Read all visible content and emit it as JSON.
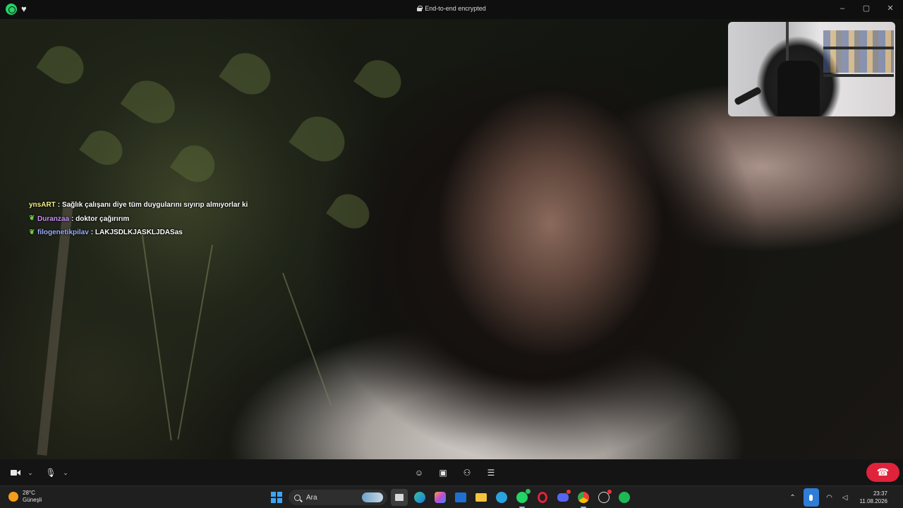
{
  "titlebar": {
    "title": "End-to-end encrypted",
    "app_icon": "whatsapp-icon",
    "extra_icon": "heart-icon",
    "controls": [
      "minimize-icon",
      "maximize-icon",
      "close-icon"
    ]
  },
  "chat": [
    {
      "user": "ynsART",
      "message": ": Sağlık çalışanı diye tüm duygularını sıyırıp almıyorlar ki",
      "badge": false
    },
    {
      "user": "Duranzaa",
      "message": ": doktor çağırırım",
      "badge": true
    },
    {
      "user": "filogenetikpilav",
      "message": ": LAKJSDLKJASKLJDASas",
      "badge": true
    }
  ],
  "call_controls": {
    "left": [
      "video-camera-icon",
      "chevron-down-icon",
      "microphone-icon",
      "chevron-down-icon"
    ],
    "center": [
      "emoji-icon",
      "screen-share-icon",
      "add-participant-icon",
      "captions-icon"
    ],
    "end_call": "end-call-icon",
    "end_call_color": "#e0223a"
  },
  "taskbar": {
    "weather_temp": "28°C",
    "weather_desc": "Güneşli",
    "search_placeholder": "Ara",
    "time": "23:37",
    "date": "11.08.2026",
    "apps": [
      "windows-start-icon",
      "search-box",
      "file-manager-icon",
      "edge-icon",
      "copilot-icon",
      "outlook-icon",
      "folder-icon",
      "telegram-icon",
      "whatsapp-icon",
      "opera-icon",
      "discord-icon",
      "chrome-icon",
      "github-icon",
      "spotify-icon"
    ]
  },
  "tray": [
    "chevron-up-icon",
    "microphone-active-icon",
    "wifi-icon",
    "volume-icon"
  ]
}
